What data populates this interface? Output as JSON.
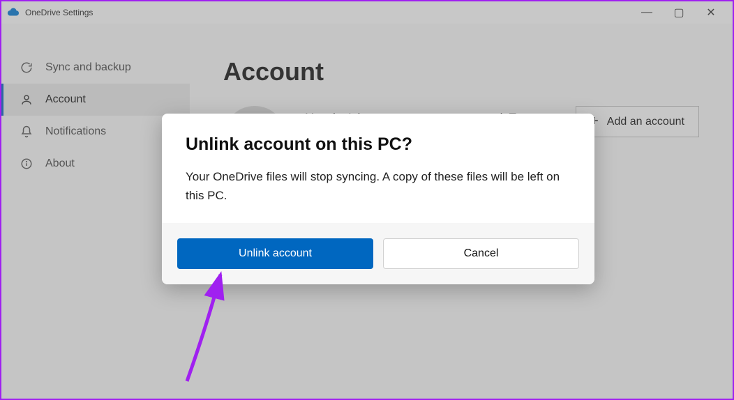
{
  "window": {
    "title": "OneDrive Settings",
    "controls": {
      "minimize": "—",
      "maximize": "▢",
      "close": "✕"
    }
  },
  "sidebar": {
    "items": [
      {
        "label": "Sync and backup",
        "icon": "sync-icon"
      },
      {
        "label": "Account",
        "icon": "account-icon"
      },
      {
        "label": "Notifications",
        "icon": "bell-icon"
      },
      {
        "label": "About",
        "icon": "info-icon"
      }
    ],
    "active_index": 1
  },
  "main": {
    "heading": "Account",
    "account_text": "You don't have an account connected. To",
    "add_account_label": "Add an account",
    "add_icon_glyph": "+"
  },
  "dialog": {
    "title": "Unlink account on this PC?",
    "body": "Your OneDrive files will stop syncing. A copy of these files will be left on this PC.",
    "primary_label": "Unlink account",
    "secondary_label": "Cancel"
  },
  "annotation": {
    "arrow_color": "#a020f0"
  }
}
